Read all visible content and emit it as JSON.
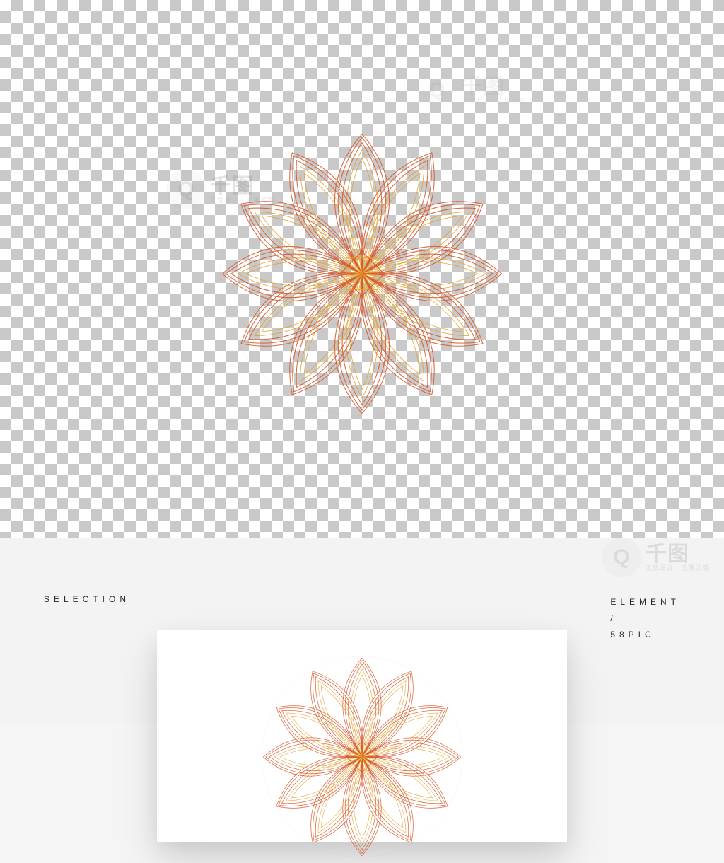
{
  "labels": {
    "left_heading": "SELECTION",
    "left_dash": "—",
    "right_heading": "ELEMENT",
    "right_slash": "/",
    "right_source": "58PIC"
  },
  "watermark": {
    "badge_letter": "Q",
    "brand_cn": "千图",
    "tagline_cn": "无忧设计 · 无限灵感"
  },
  "ornament": {
    "color_outer": "#d85a2b",
    "color_inner": "#e6a028",
    "petals": 12
  }
}
